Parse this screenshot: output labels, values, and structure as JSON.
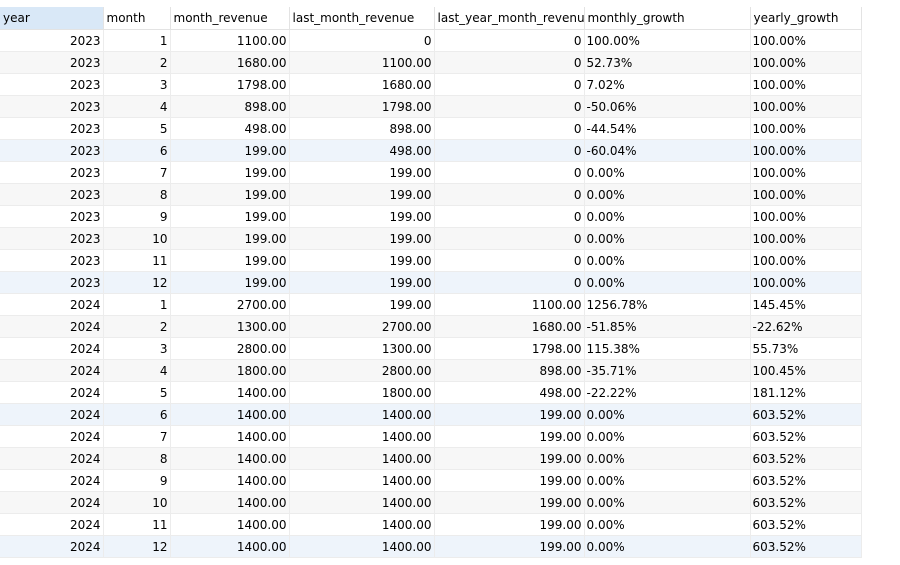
{
  "colors": {
    "sorted_header_bg": "#d9e8f7",
    "highlight_row_bg": "#eef4fb"
  },
  "columns": [
    "year",
    "month",
    "month_revenue",
    "last_month_revenue",
    "last_year_month_revenue",
    "monthly_growth",
    "yearly_growth"
  ],
  "rows": [
    [
      "2023",
      "1",
      "1100.00",
      "0",
      "0",
      "100.00%",
      "100.00%"
    ],
    [
      "2023",
      "2",
      "1680.00",
      "1100.00",
      "0",
      "52.73%",
      "100.00%"
    ],
    [
      "2023",
      "3",
      "1798.00",
      "1680.00",
      "0",
      "7.02%",
      "100.00%"
    ],
    [
      "2023",
      "4",
      "898.00",
      "1798.00",
      "0",
      "-50.06%",
      "100.00%"
    ],
    [
      "2023",
      "5",
      "498.00",
      "898.00",
      "0",
      "-44.54%",
      "100.00%"
    ],
    [
      "2023",
      "6",
      "199.00",
      "498.00",
      "0",
      "-60.04%",
      "100.00%"
    ],
    [
      "2023",
      "7",
      "199.00",
      "199.00",
      "0",
      "0.00%",
      "100.00%"
    ],
    [
      "2023",
      "8",
      "199.00",
      "199.00",
      "0",
      "0.00%",
      "100.00%"
    ],
    [
      "2023",
      "9",
      "199.00",
      "199.00",
      "0",
      "0.00%",
      "100.00%"
    ],
    [
      "2023",
      "10",
      "199.00",
      "199.00",
      "0",
      "0.00%",
      "100.00%"
    ],
    [
      "2023",
      "11",
      "199.00",
      "199.00",
      "0",
      "0.00%",
      "100.00%"
    ],
    [
      "2023",
      "12",
      "199.00",
      "199.00",
      "0",
      "0.00%",
      "100.00%"
    ],
    [
      "2024",
      "1",
      "2700.00",
      "199.00",
      "1100.00",
      "1256.78%",
      "145.45%"
    ],
    [
      "2024",
      "2",
      "1300.00",
      "2700.00",
      "1680.00",
      "-51.85%",
      "-22.62%"
    ],
    [
      "2024",
      "3",
      "2800.00",
      "1300.00",
      "1798.00",
      "115.38%",
      "55.73%"
    ],
    [
      "2024",
      "4",
      "1800.00",
      "2800.00",
      "898.00",
      "-35.71%",
      "100.45%"
    ],
    [
      "2024",
      "5",
      "1400.00",
      "1800.00",
      "498.00",
      "-22.22%",
      "181.12%"
    ],
    [
      "2024",
      "6",
      "1400.00",
      "1400.00",
      "199.00",
      "0.00%",
      "603.52%"
    ],
    [
      "2024",
      "7",
      "1400.00",
      "1400.00",
      "199.00",
      "0.00%",
      "603.52%"
    ],
    [
      "2024",
      "8",
      "1400.00",
      "1400.00",
      "199.00",
      "0.00%",
      "603.52%"
    ],
    [
      "2024",
      "9",
      "1400.00",
      "1400.00",
      "199.00",
      "0.00%",
      "603.52%"
    ],
    [
      "2024",
      "10",
      "1400.00",
      "1400.00",
      "199.00",
      "0.00%",
      "603.52%"
    ],
    [
      "2024",
      "11",
      "1400.00",
      "1400.00",
      "199.00",
      "0.00%",
      "603.52%"
    ],
    [
      "2024",
      "12",
      "1400.00",
      "1400.00",
      "199.00",
      "0.00%",
      "603.52%"
    ]
  ]
}
